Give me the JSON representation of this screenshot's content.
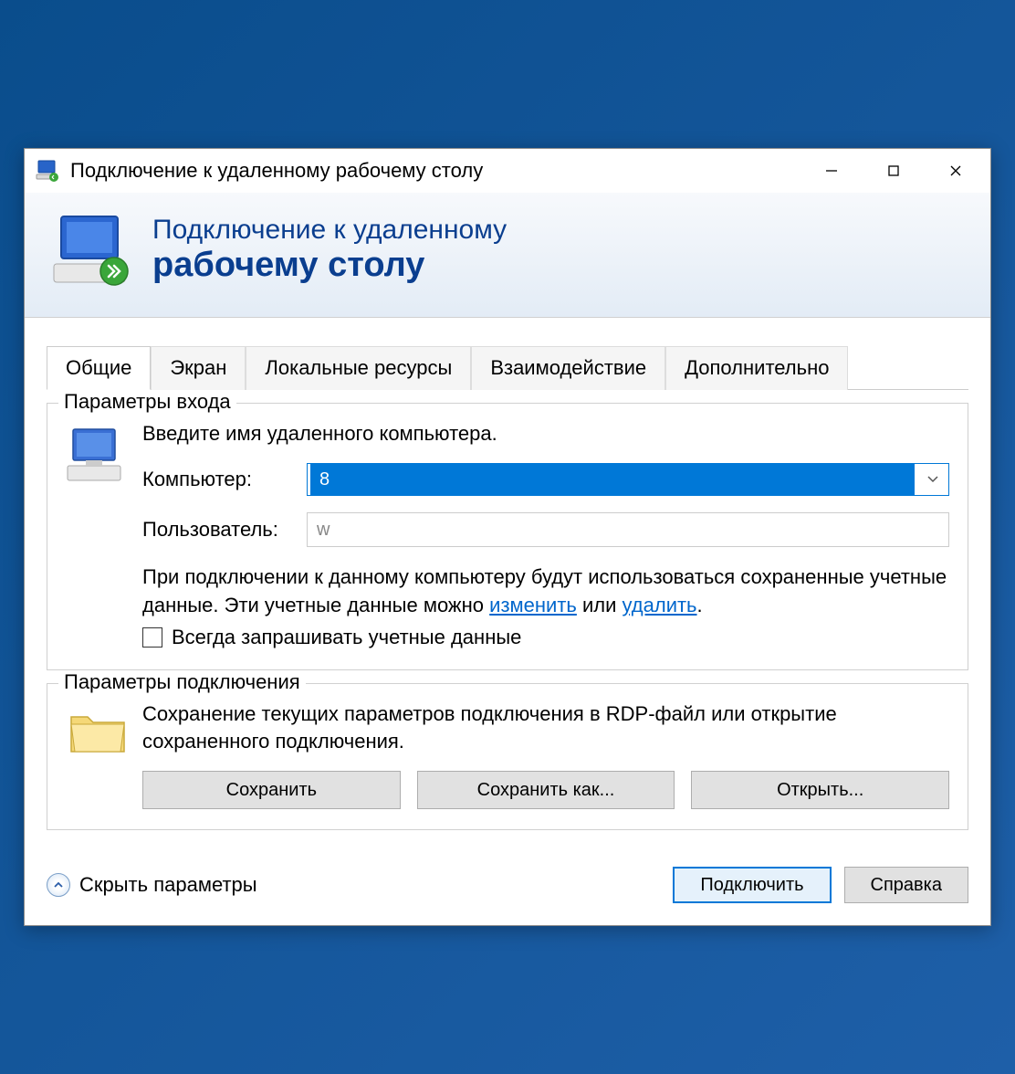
{
  "titlebar": {
    "title": "Подключение к удаленному рабочему столу"
  },
  "header": {
    "line1": "Подключение к удаленному",
    "line2": "рабочему столу"
  },
  "tabs": [
    {
      "label": "Общие",
      "active": true
    },
    {
      "label": "Экран",
      "active": false
    },
    {
      "label": "Локальные ресурсы",
      "active": false
    },
    {
      "label": "Взаимодействие",
      "active": false
    },
    {
      "label": "Дополнительно",
      "active": false
    }
  ],
  "login_group": {
    "legend": "Параметры входа",
    "instruction": "Введите имя удаленного компьютера.",
    "computer_label": "Компьютер:",
    "computer_value": "8",
    "user_label": "Пользователь:",
    "user_value": "w",
    "cred_text_1": "При подключении к данному компьютеру будут использоваться сохраненные учетные данные.  Эти учетные данные можно ",
    "cred_link_change": "изменить",
    "cred_text_or": " или ",
    "cred_link_delete": "удалить",
    "cred_text_end": ".",
    "checkbox_label": "Всегда запрашивать учетные данные"
  },
  "conn_group": {
    "legend": "Параметры подключения",
    "instruction": "Сохранение текущих параметров подключения в RDP-файл или открытие сохраненного подключения.",
    "save_label": "Сохранить",
    "save_as_label": "Сохранить как...",
    "open_label": "Открыть..."
  },
  "footer": {
    "collapse_label": "Скрыть параметры",
    "connect_label": "Подключить",
    "help_label": "Справка"
  }
}
